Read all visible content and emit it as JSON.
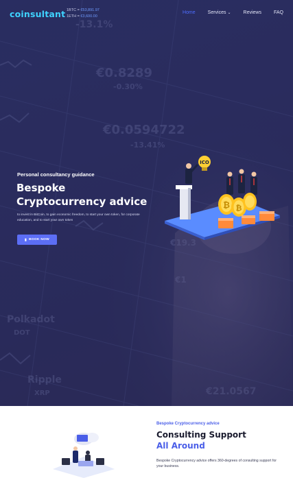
{
  "header": {
    "logo": "coinsultant",
    "ticker": [
      {
        "label": "1BTC = ",
        "value": "€53,891.97"
      },
      {
        "label": "1ETH = ",
        "value": "€3,600.00"
      }
    ],
    "nav": [
      {
        "label": "Home",
        "active": true
      },
      {
        "label": "Services",
        "dropdown": true
      },
      {
        "label": "Reviews"
      },
      {
        "label": "FAQ"
      }
    ]
  },
  "hero": {
    "eyebrow": "Personal consultancy guidance",
    "title_line1": "Bespoke",
    "title_line2": "Cryptocurrency advice",
    "description": "to invest in BitCoin, to gain economic freedom, to start your own token, for corporate education, and to start your own token",
    "button_label": "BOOK NOW",
    "illustration_label": "ICO"
  },
  "section2": {
    "eyebrow": "Bespoke Cryptocurrency advice",
    "title_line1": "Consulting Support",
    "title_line2": "All Around",
    "description": "Bespoke Cryptocurrency advice offers 360-degrees of consulting support for your business."
  },
  "colors": {
    "accent": "#4a5ee8",
    "logo": "#3fd3ff",
    "button": "#5c6ef5",
    "hero_bg": "#2b2d5e"
  }
}
